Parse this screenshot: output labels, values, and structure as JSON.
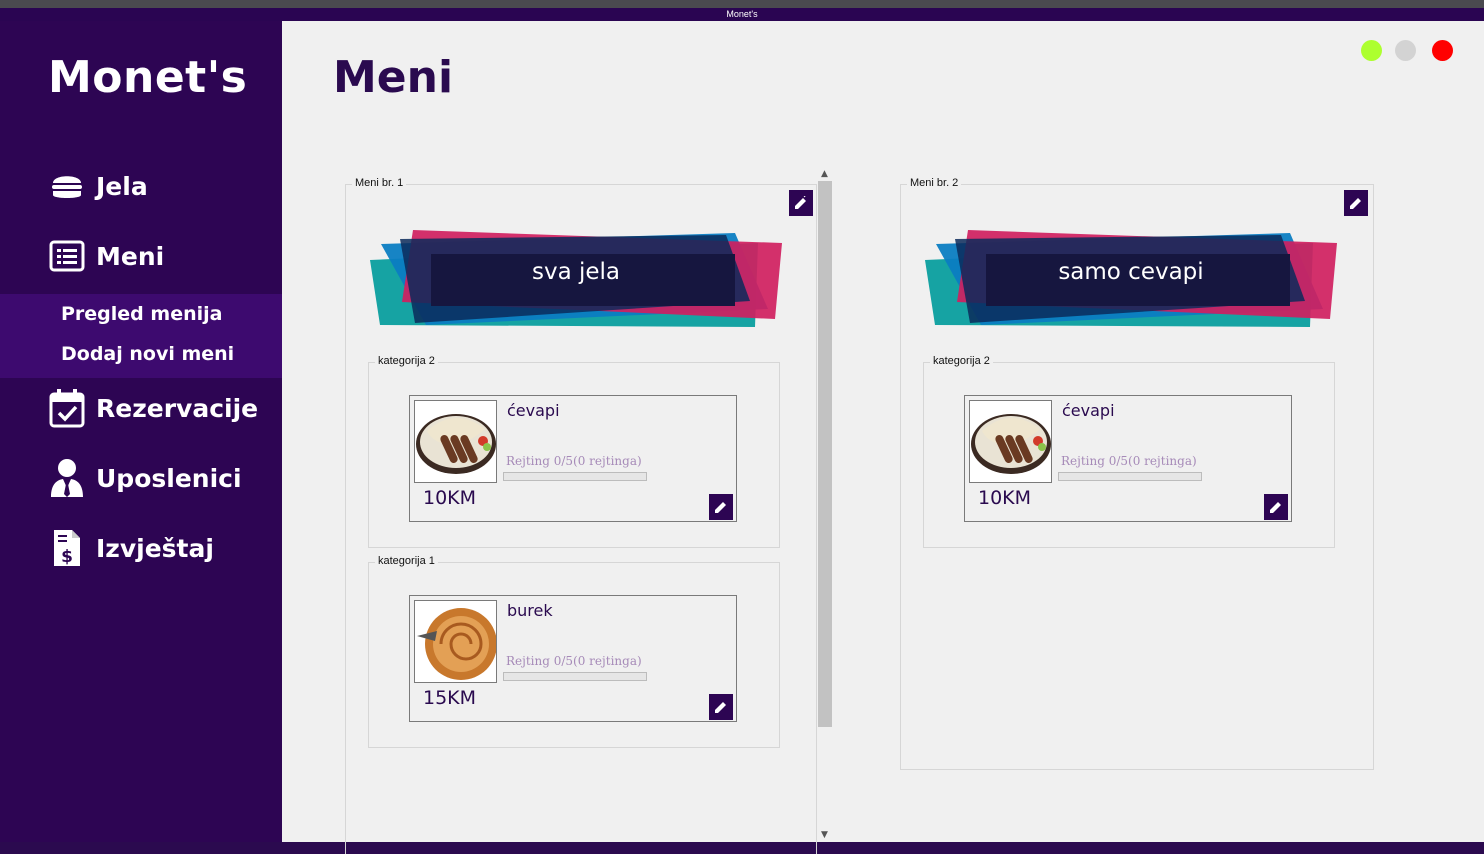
{
  "window": {
    "title": "Monet's"
  },
  "sidebar": {
    "brand": "Monet's",
    "items": [
      {
        "label": "Jela",
        "icon": "hamburger-icon"
      },
      {
        "label": "Meni",
        "icon": "menu-list-icon"
      },
      {
        "label": "Rezervacije",
        "icon": "calendar-check-icon"
      },
      {
        "label": "Uposlenici",
        "icon": "user-tie-icon"
      },
      {
        "label": "Izvještaj",
        "icon": "invoice-dollar-icon"
      }
    ],
    "submenu": [
      {
        "label": "Pregled menija"
      },
      {
        "label": "Dodaj novi meni"
      }
    ]
  },
  "main": {
    "title": "Meni"
  },
  "colors": {
    "sidebar": "#2d0553",
    "submenu": "#3d0a6f",
    "accent": "#2a0a4f",
    "minimize": "#adff2f",
    "maximize": "#d3d3d3",
    "close": "#ff0000"
  },
  "menus": [
    {
      "label": "Meni br. 1",
      "banner": "sva jela",
      "categories": [
        {
          "label": "kategorija 2",
          "dish": {
            "name": "ćevapi",
            "rating": "Rejting 0/5(0 rejtinga)",
            "rating_value": 0,
            "price": "10KM",
            "image": "cevapi-photo"
          }
        },
        {
          "label": "kategorija 1",
          "dish": {
            "name": "burek",
            "rating": "Rejting 0/5(0 rejtinga)",
            "rating_value": 0,
            "price": "15KM",
            "image": "burek-photo"
          }
        }
      ]
    },
    {
      "label": "Meni br. 2",
      "banner": "samo cevapi",
      "categories": [
        {
          "label": "kategorija 2",
          "dish": {
            "name": "ćevapi",
            "rating": "Rejting 0/5(0 rejtinga)",
            "rating_value": 0,
            "price": "10KM",
            "image": "cevapi-photo"
          }
        }
      ]
    }
  ]
}
